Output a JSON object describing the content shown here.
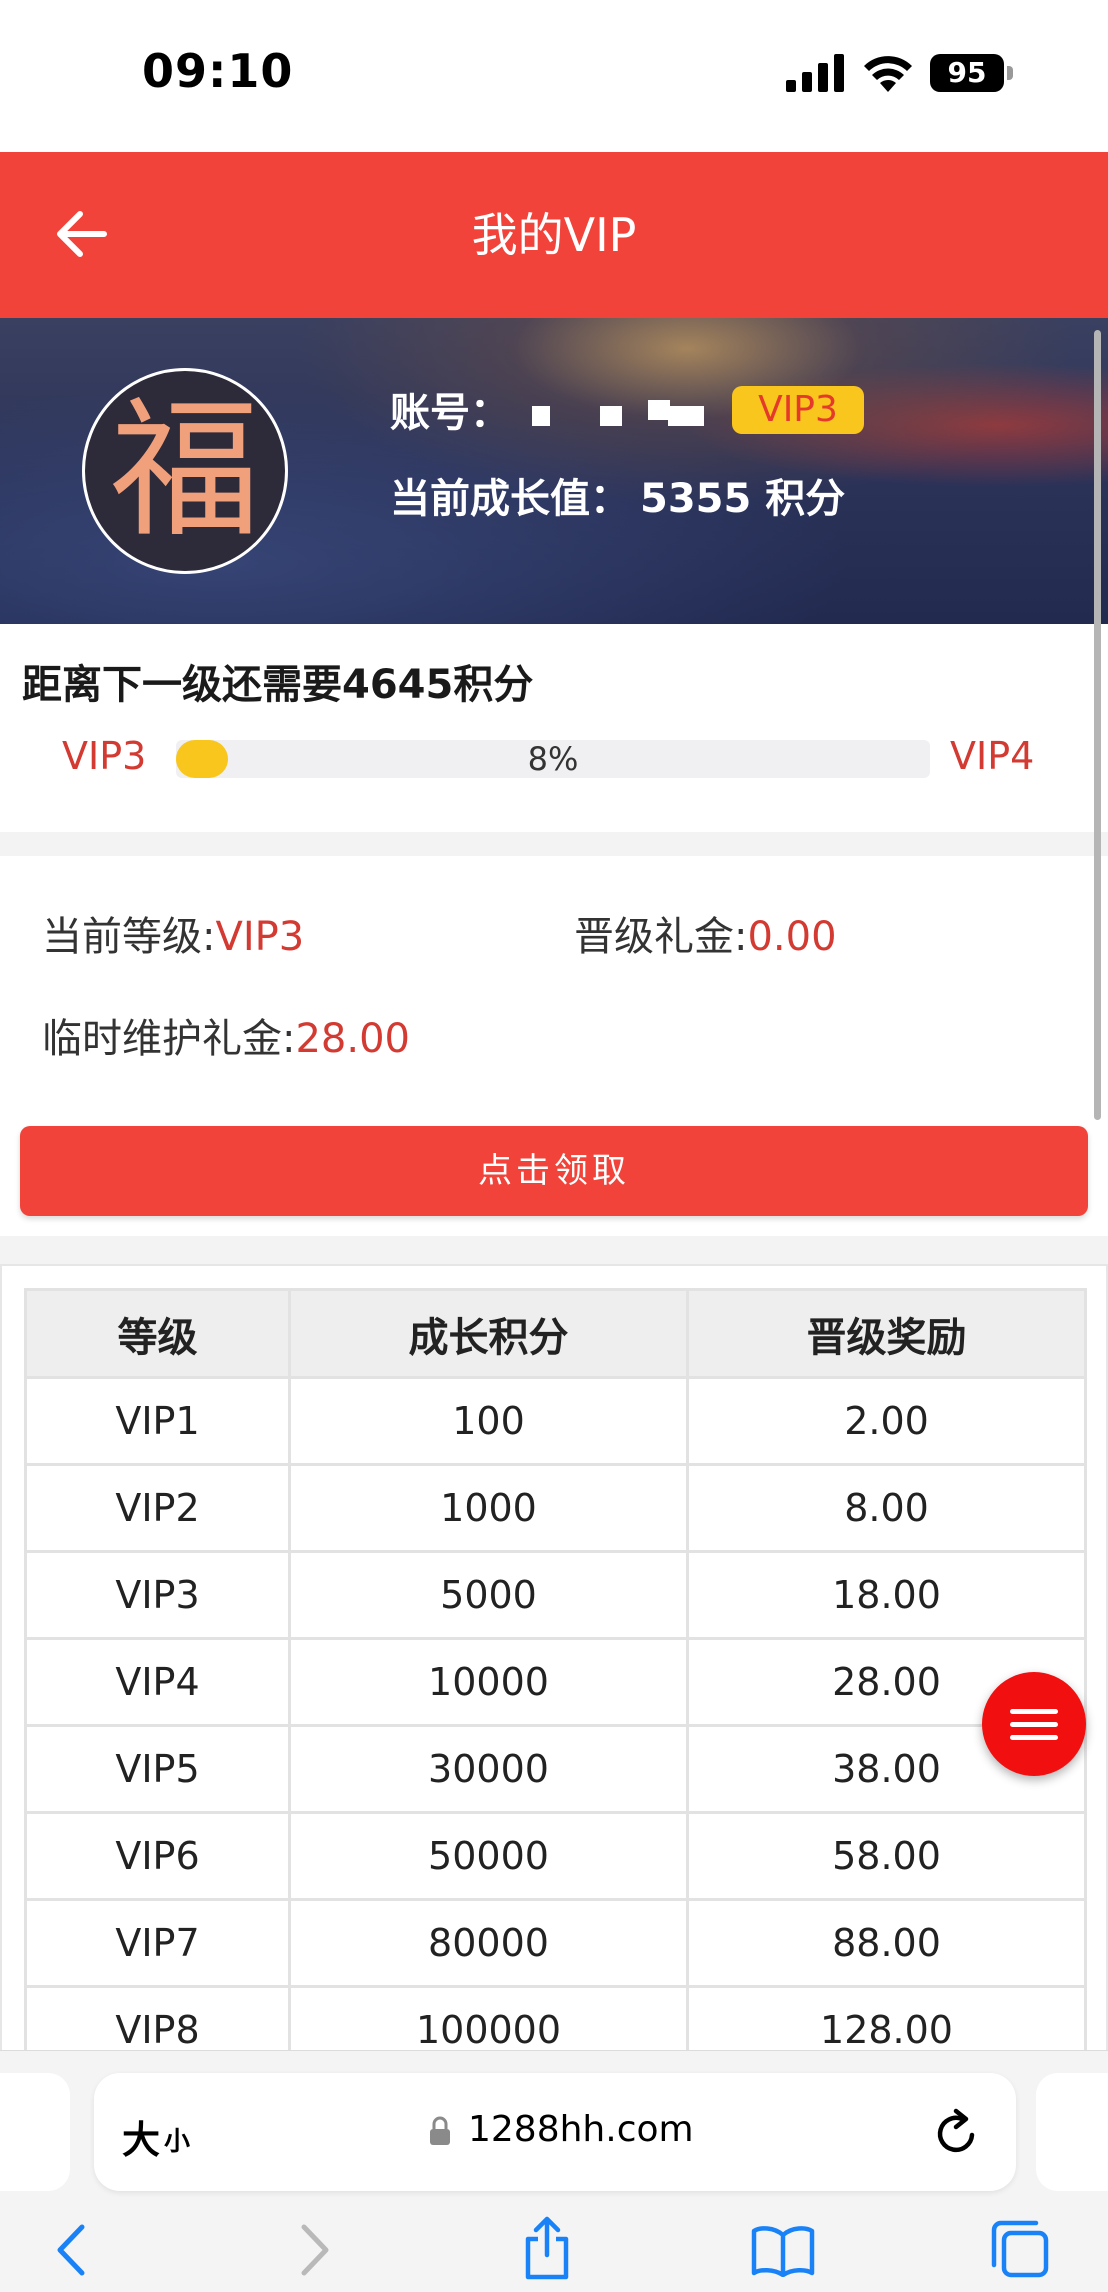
{
  "status_bar": {
    "time": "09:10",
    "battery": "95"
  },
  "header": {
    "title": "我的VIP"
  },
  "profile": {
    "account_label": "账号：",
    "vip_badge": "VIP3",
    "growth_label": "当前成长值：",
    "growth_value": "5355 积分"
  },
  "progress": {
    "next_level_text": "距离下一级还需要4645积分",
    "from_level": "VIP3",
    "to_level": "VIP4",
    "percent_text": "8%",
    "percent_value": 8
  },
  "level_info": {
    "current_level_label": "当前等级:",
    "current_level_value": "VIP3",
    "upgrade_bonus_label": "晋级礼金:",
    "upgrade_bonus_value": "0.00",
    "maintenance_bonus_label": "临时维护礼金:",
    "maintenance_bonus_value": "28.00"
  },
  "claim_button": {
    "label": "点击领取"
  },
  "table": {
    "headers": [
      "等级",
      "成长积分",
      "晋级奖励"
    ],
    "rows": [
      [
        "VIP1",
        "100",
        "2.00"
      ],
      [
        "VIP2",
        "1000",
        "8.00"
      ],
      [
        "VIP3",
        "5000",
        "18.00"
      ],
      [
        "VIP4",
        "10000",
        "28.00"
      ],
      [
        "VIP5",
        "30000",
        "38.00"
      ],
      [
        "VIP6",
        "50000",
        "58.00"
      ],
      [
        "VIP7",
        "80000",
        "88.00"
      ],
      [
        "VIP8",
        "100000",
        "128.00"
      ]
    ]
  },
  "browser": {
    "text_size_big": "大",
    "text_size_small": "小",
    "url": "1288hh.com"
  },
  "colors": {
    "brand_red": "#f1433a",
    "accent_yellow": "#f8c61c",
    "value_red": "#d23a32",
    "safari_blue": "#1a82f7"
  },
  "icons": {
    "back": "arrow-left-icon",
    "fab": "menu-icon",
    "lock": "lock-icon",
    "reload": "reload-icon",
    "browser_back": "chevron-left-icon",
    "browser_forward": "chevron-right-icon",
    "share": "share-icon",
    "bookmarks": "book-icon",
    "tabs": "tabs-icon"
  }
}
